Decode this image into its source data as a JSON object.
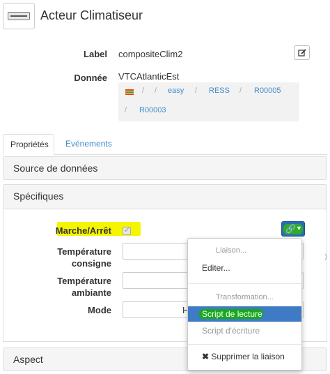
{
  "header": {
    "title": "Acteur Climatiseur"
  },
  "fields": {
    "label_caption": "Label",
    "label_value": "compositeClim2",
    "donnee_caption": "Donnée",
    "donnee_value": "VTCAtlanticEst"
  },
  "breadcrumb": {
    "separator": "/",
    "items": [
      "easy",
      "RESS",
      "R00005",
      "R00003"
    ]
  },
  "tabs": {
    "proprietes": "Propriétés",
    "evenements": "Evénements"
  },
  "panels": {
    "source": "Source de données",
    "specifiques": "Spécifiques",
    "aspect": "Aspect"
  },
  "spec": {
    "marche_arret": "Marche/Arrêt",
    "temp_consigne_1": "Température",
    "temp_consigne_2": "consigne",
    "temp_ambiante_1": "Température",
    "temp_ambiante_2": "ambiante",
    "mode": "Mode",
    "mode_value": "H"
  },
  "menu": {
    "liaison_header": "Liaison...",
    "editer": "Editer...",
    "transformation_header": "Transformation...",
    "script_lecture": "Script de lecture",
    "script_ecriture": "Script d'écriture",
    "supprimer": "Supprimer la liaison"
  },
  "colors": {
    "accent": "#428bca",
    "button": "#2a6bb5",
    "highlight_yellow": "#f5f500",
    "highlight_green": "#19a81d"
  }
}
